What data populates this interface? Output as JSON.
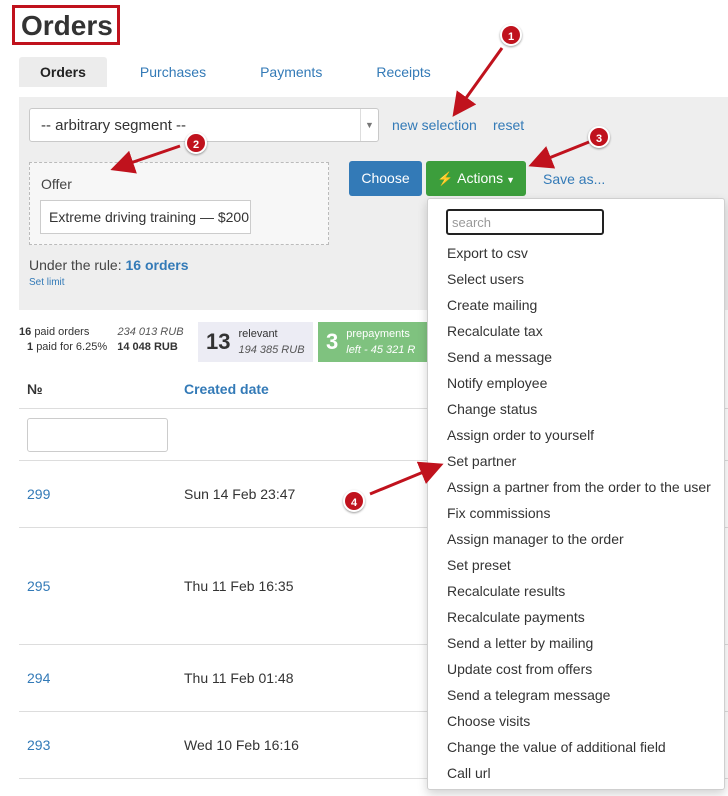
{
  "page_title": "Orders",
  "tabs": [
    {
      "label": "Orders",
      "active": true
    },
    {
      "label": "Purchases"
    },
    {
      "label": "Payments"
    },
    {
      "label": "Receipts"
    }
  ],
  "filter": {
    "segment_value": "-- arbitrary segment --",
    "new_selection": "new selection",
    "reset": "reset",
    "offer_label": "Offer",
    "offer_value": "Extreme driving training — $200",
    "rule_label": "Under the rule:",
    "rule_count": "16 orders",
    "set_limit": "Set limit"
  },
  "buttons": {
    "choose": "Choose",
    "actions": "Actions",
    "save_as": "Save as..."
  },
  "stats": {
    "paid_orders_count": "16",
    "paid_orders_label": "paid orders",
    "paid_orders_amount": "234 013 RUB",
    "paid_for_count": "1",
    "paid_for_label": "paid for 6.25%",
    "paid_for_amount": "14 048 RUB",
    "relevant_count": "13",
    "relevant_label": "relevant",
    "relevant_amount": "194 385 RUB",
    "prepay_count": "3",
    "prepay_label": "prepayments",
    "prepay_left": "left - 45 321 R"
  },
  "table": {
    "col_no": "№",
    "col_created": "Created date",
    "rows": [
      {
        "number": "299",
        "date": "Sun 14 Feb 23:47"
      },
      {
        "number": "295",
        "date": "Thu 11 Feb 16:35"
      },
      {
        "number": "294",
        "date": "Thu 11 Feb 01:48"
      },
      {
        "number": "293",
        "date": "Wed 10 Feb 16:16"
      }
    ]
  },
  "actions_menu": {
    "search_placeholder": "search",
    "items": [
      "Export to csv",
      "Select users",
      "Create mailing",
      "Recalculate tax",
      "Send a message",
      "Notify employee",
      "Change status",
      "Assign order to yourself",
      "Set partner",
      "Assign a partner from the order to the user",
      "Fix commissions",
      "Assign manager to the order",
      "Set preset",
      "Recalculate results",
      "Recalculate payments",
      "Send a letter by mailing",
      "Update cost from offers",
      "Send a telegram message",
      "Choose visits",
      "Change the value of additional field",
      "Call url"
    ]
  },
  "annotations": [
    "1",
    "2",
    "3",
    "4"
  ],
  "colors": {
    "accent_blue": "#337ab7",
    "actions_green": "#3c9e3c",
    "prepay_green": "#7fc27f",
    "annotation_red": "#c0121d"
  }
}
